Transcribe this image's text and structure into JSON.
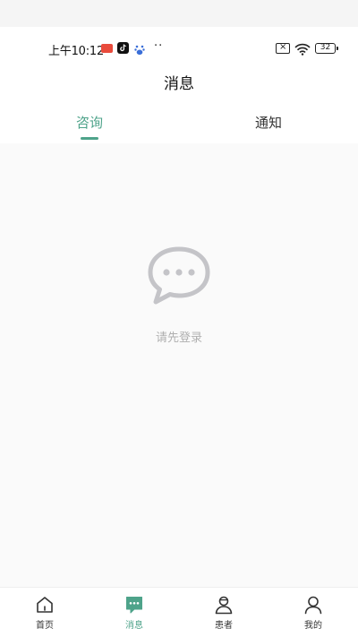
{
  "status_bar": {
    "time": "上午10:12",
    "dots": "··",
    "battery": "32"
  },
  "header": {
    "title": "消息"
  },
  "tabs": [
    {
      "label": "咨询",
      "active": true
    },
    {
      "label": "通知",
      "active": false
    }
  ],
  "empty_state": {
    "icon": "chat-bubble-icon",
    "message": "请先登录"
  },
  "bottom_nav": [
    {
      "label": "首页",
      "icon": "home-icon",
      "active": false
    },
    {
      "label": "消息",
      "icon": "message-icon",
      "active": true
    },
    {
      "label": "患者",
      "icon": "patient-icon",
      "active": false
    },
    {
      "label": "我的",
      "icon": "profile-icon",
      "active": false
    }
  ],
  "colors": {
    "accent": "#4ea38a",
    "muted_text": "#b0b0b0",
    "icon_gray": "#c4c4c8"
  }
}
